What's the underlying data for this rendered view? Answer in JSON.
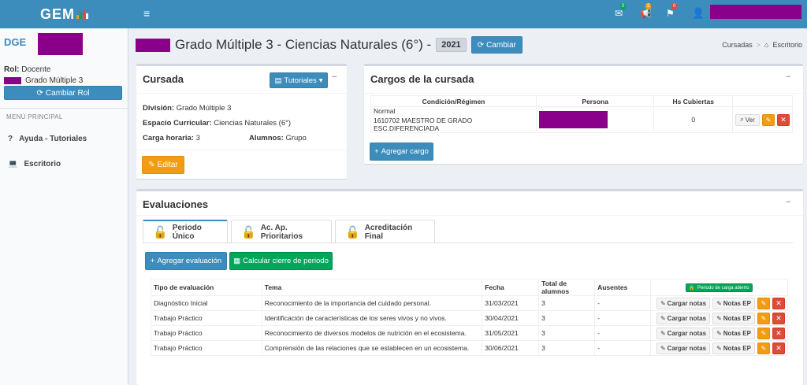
{
  "topbar": {
    "logo_text": "GEM",
    "logo_bar_colors": [
      "#f39c12",
      "#00a65a",
      "#dd4b39",
      "#ffffff"
    ],
    "menu_glyph": "≡",
    "notifications": [
      {
        "icon": "envelope-icon",
        "count": "0",
        "color": "#00a65a"
      },
      {
        "icon": "bullhorn-icon",
        "count": "2",
        "color": "#f39c12"
      },
      {
        "icon": "flag-icon",
        "count": "0",
        "color": "#dd4b39"
      }
    ]
  },
  "sidebar": {
    "brand_text": "DGE",
    "rol_label": "Rol:",
    "rol_value": "Docente",
    "grado": "Grado Múltiple 3",
    "cambiar_rol": "Cambiar Rol",
    "menu_header": "MENÚ PRINCIPAL",
    "items": [
      {
        "icon": "question-icon",
        "label": "Ayuda - Tutoriales"
      },
      {
        "icon": "laptop-icon",
        "label": "Escritorio"
      }
    ]
  },
  "header": {
    "title": "Grado Múltiple 3 - Ciencias Naturales (6°) -",
    "year": "2021",
    "cambiar": "Cambiar",
    "breadcrumb": [
      "Cursadas",
      "Escritorio"
    ]
  },
  "cursada": {
    "title": "Cursada",
    "tutoriales": "Tutoriales",
    "division_label": "División:",
    "division_value": "Grado Múltiple 3",
    "espacio_label": "Espacio Curricular:",
    "espacio_value": "Ciencias Naturales (6°)",
    "carga_label": "Carga horaria:",
    "carga_value": "3",
    "alumnos_label": "Alumnos:",
    "alumnos_value": "Grupo",
    "editar": "Editar"
  },
  "cargos": {
    "title": "Cargos de la cursada",
    "headers": [
      "Condición/Régimen",
      "Persona",
      "Hs Cubiertas"
    ],
    "row": {
      "condicion": "Normal",
      "cargo": "1610702 MAESTRO DE GRADO ESC.DIFERENCIADA",
      "hs": "0",
      "ver": "Ver"
    },
    "agregar": "Agregar cargo"
  },
  "evaluaciones": {
    "title": "Evaluaciones",
    "tabs": [
      "Periodo Único",
      "Ac. Ap. Prioritarios",
      "Acreditación Final"
    ],
    "agregar": "Agregar evaluación",
    "calcular": "Calcular cierre de periodo",
    "headers": [
      "Tipo de evaluación",
      "Tema",
      "Fecha",
      "Total de alumnos",
      "Ausentes"
    ],
    "periodo_badge": "Periodo de carga abierto",
    "cargar_notas": "Cargar notas",
    "notas_ep": "Notas EP",
    "rows": [
      {
        "tipo": "Diagnóstico Inicial",
        "tema": "Reconocimiento de la importancia del cuidado personal.",
        "fecha": "31/03/2021",
        "total": "3",
        "ausentes": "-"
      },
      {
        "tipo": "Trabajo Práctico",
        "tema": "Identificación de características de los seres vivos y no vivos.",
        "fecha": "30/04/2021",
        "total": "3",
        "ausentes": "-"
      },
      {
        "tipo": "Trabajo Práctico",
        "tema": "Reconocimiento de diversos modelos de nutrición en el ecosistema.",
        "fecha": "31/05/2021",
        "total": "3",
        "ausentes": "-"
      },
      {
        "tipo": "Trabajo Práctico",
        "tema": "Comprensión de las relaciones que se establecen en un ecosistema.",
        "fecha": "30/06/2021",
        "total": "3",
        "ausentes": "-"
      }
    ]
  },
  "colors": {
    "primary": "#3c8dbc",
    "warning": "#f39c12",
    "danger": "#dd4b39",
    "success": "#00a65a",
    "redaction": "#8b008b"
  }
}
